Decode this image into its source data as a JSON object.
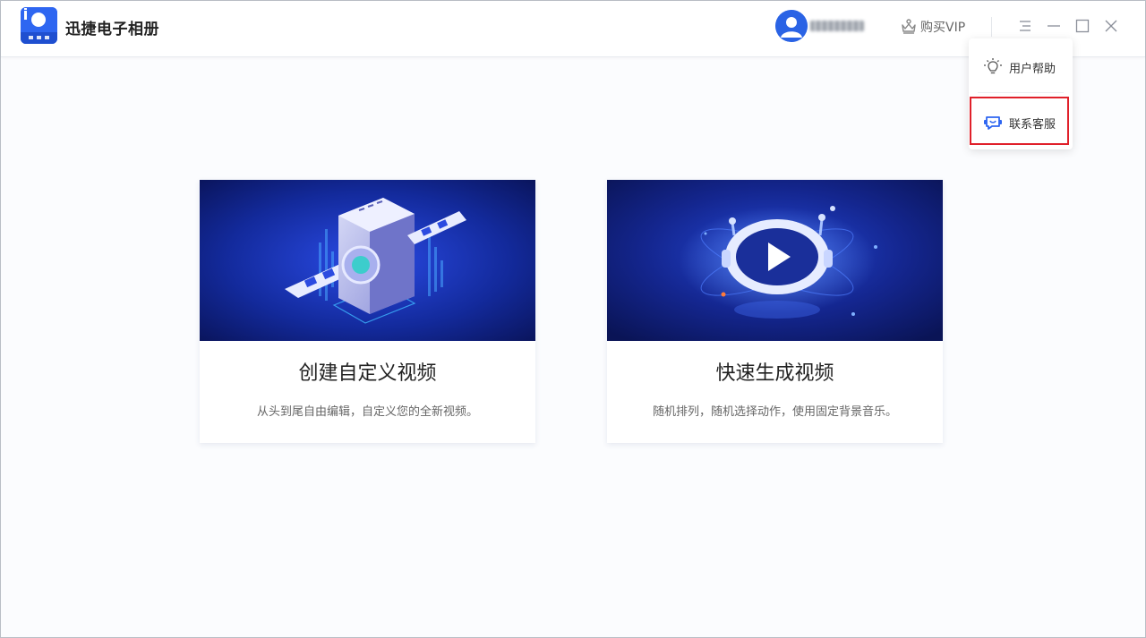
{
  "app": {
    "title": "迅捷电子相册"
  },
  "header": {
    "username": "",
    "buy_vip_label": "购买VIP"
  },
  "menu": {
    "items": [
      {
        "label": "用户帮助",
        "icon": "lightbulb-icon"
      },
      {
        "label": "联系客服",
        "icon": "customer-service-icon"
      }
    ],
    "highlighted_item": "联系客服"
  },
  "cards": [
    {
      "title": "创建自定义视频",
      "description": "从头到尾自由编辑，自定义您的全新视频。",
      "banner": "film-machine-illustration"
    },
    {
      "title": "快速生成视频",
      "description": "随机排列，随机选择动作，使用固定背景音乐。",
      "banner": "play-button-illustration"
    }
  ],
  "colors": {
    "brand_blue": "#2e66f1",
    "banner_dark": "#0d1a6b",
    "highlight_red": "#e0202a"
  }
}
